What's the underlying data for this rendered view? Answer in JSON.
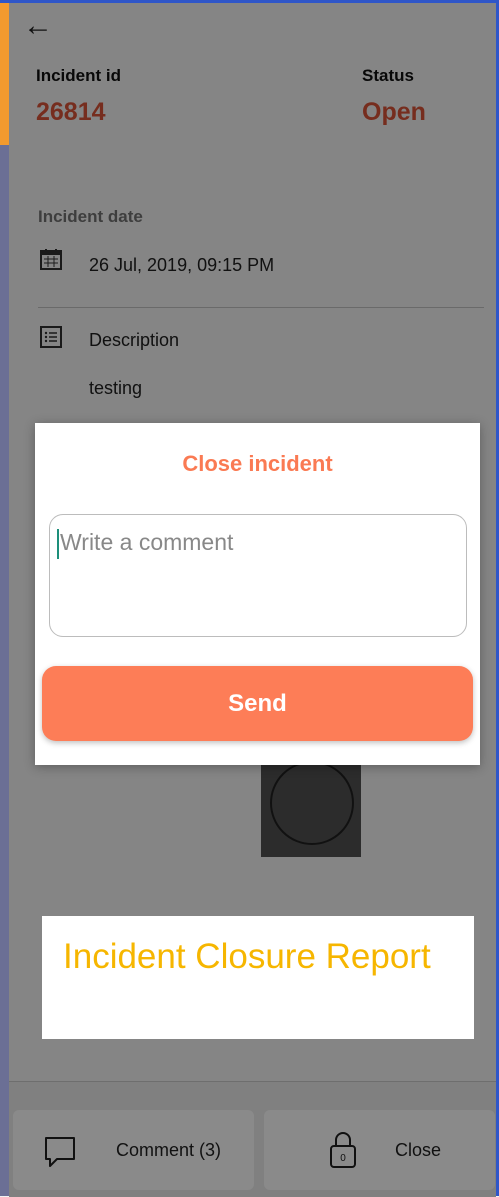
{
  "header": {
    "incident_id_label": "Incident id",
    "incident_id_value": "26814",
    "status_label": "Status",
    "status_value": "Open"
  },
  "details": {
    "incident_date_label": "Incident date",
    "incident_date_value": "26 Jul, 2019,  09:15 PM",
    "description_label": "Description",
    "description_value": "testing"
  },
  "dialog": {
    "title": "Close incident",
    "comment_placeholder": "Write a comment",
    "send_label": "Send"
  },
  "caption": {
    "text": "Incident Closure Report"
  },
  "bottom_bar": {
    "comment_label": "Comment (3)",
    "close_label": "Close"
  },
  "colors": {
    "accent": "#fd7d57",
    "status_red": "#e2573a",
    "caption_yellow": "#f6b600"
  },
  "icons": [
    "back-arrow-icon",
    "calendar-icon",
    "list-icon",
    "comment-icon",
    "lock-icon"
  ]
}
